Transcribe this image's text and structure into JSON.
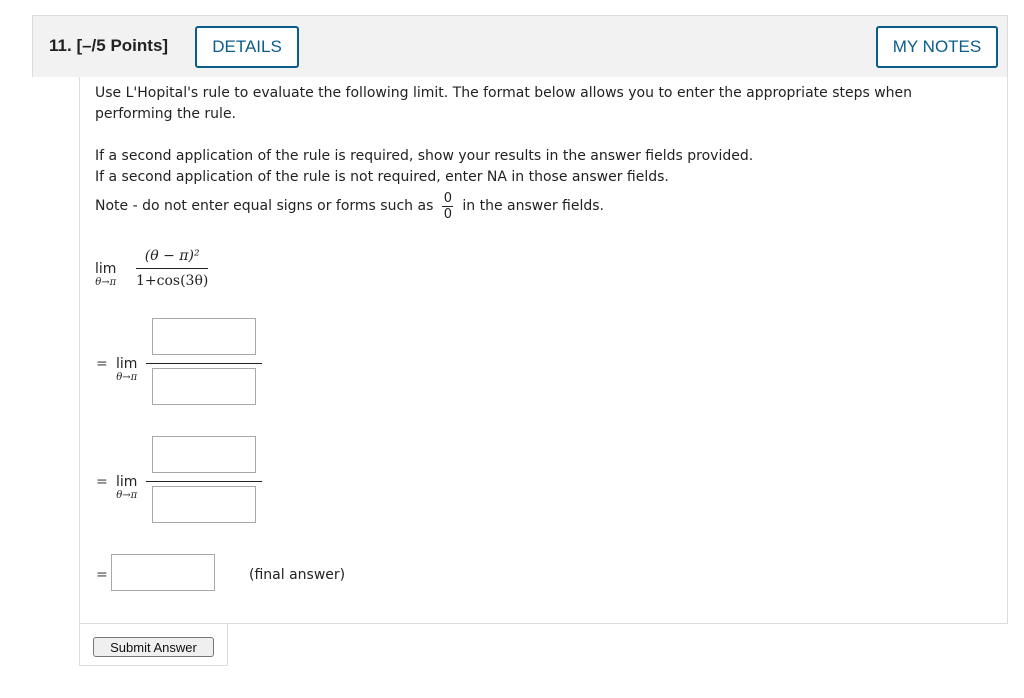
{
  "question": {
    "number": "11.",
    "points": "[–/5 Points]",
    "details_label": "DETAILS",
    "my_notes_label": "MY NOTES"
  },
  "instructions": {
    "p1": "Use L'Hopital's rule to evaluate the following limit. The format below allows you to enter the appropriate steps when performing the rule.",
    "p2": "If a second application of the rule is required, show your results in the answer fields provided.",
    "p3": "If a second application of the rule is not required, enter NA in those answer fields.",
    "p4_before": "Note - do not enter equal signs or forms such as",
    "p4_frac_num": "0",
    "p4_frac_den": "0",
    "p4_after": "in the answer fields."
  },
  "problem": {
    "lim_word": "lim",
    "lim_sub": "θ→π",
    "numerator": "(θ − π)²",
    "denominator": "1+cos(3θ)",
    "equals": "=",
    "final_label": "(final answer)"
  },
  "answers": {
    "step1_num": "",
    "step1_den": "",
    "step2_num": "",
    "step2_den": "",
    "final": ""
  },
  "submit_label": "Submit Answer",
  "colors": {
    "accent": "#0a5c8a",
    "header_bg": "#f2f2f2",
    "border": "#dcdcdc"
  }
}
